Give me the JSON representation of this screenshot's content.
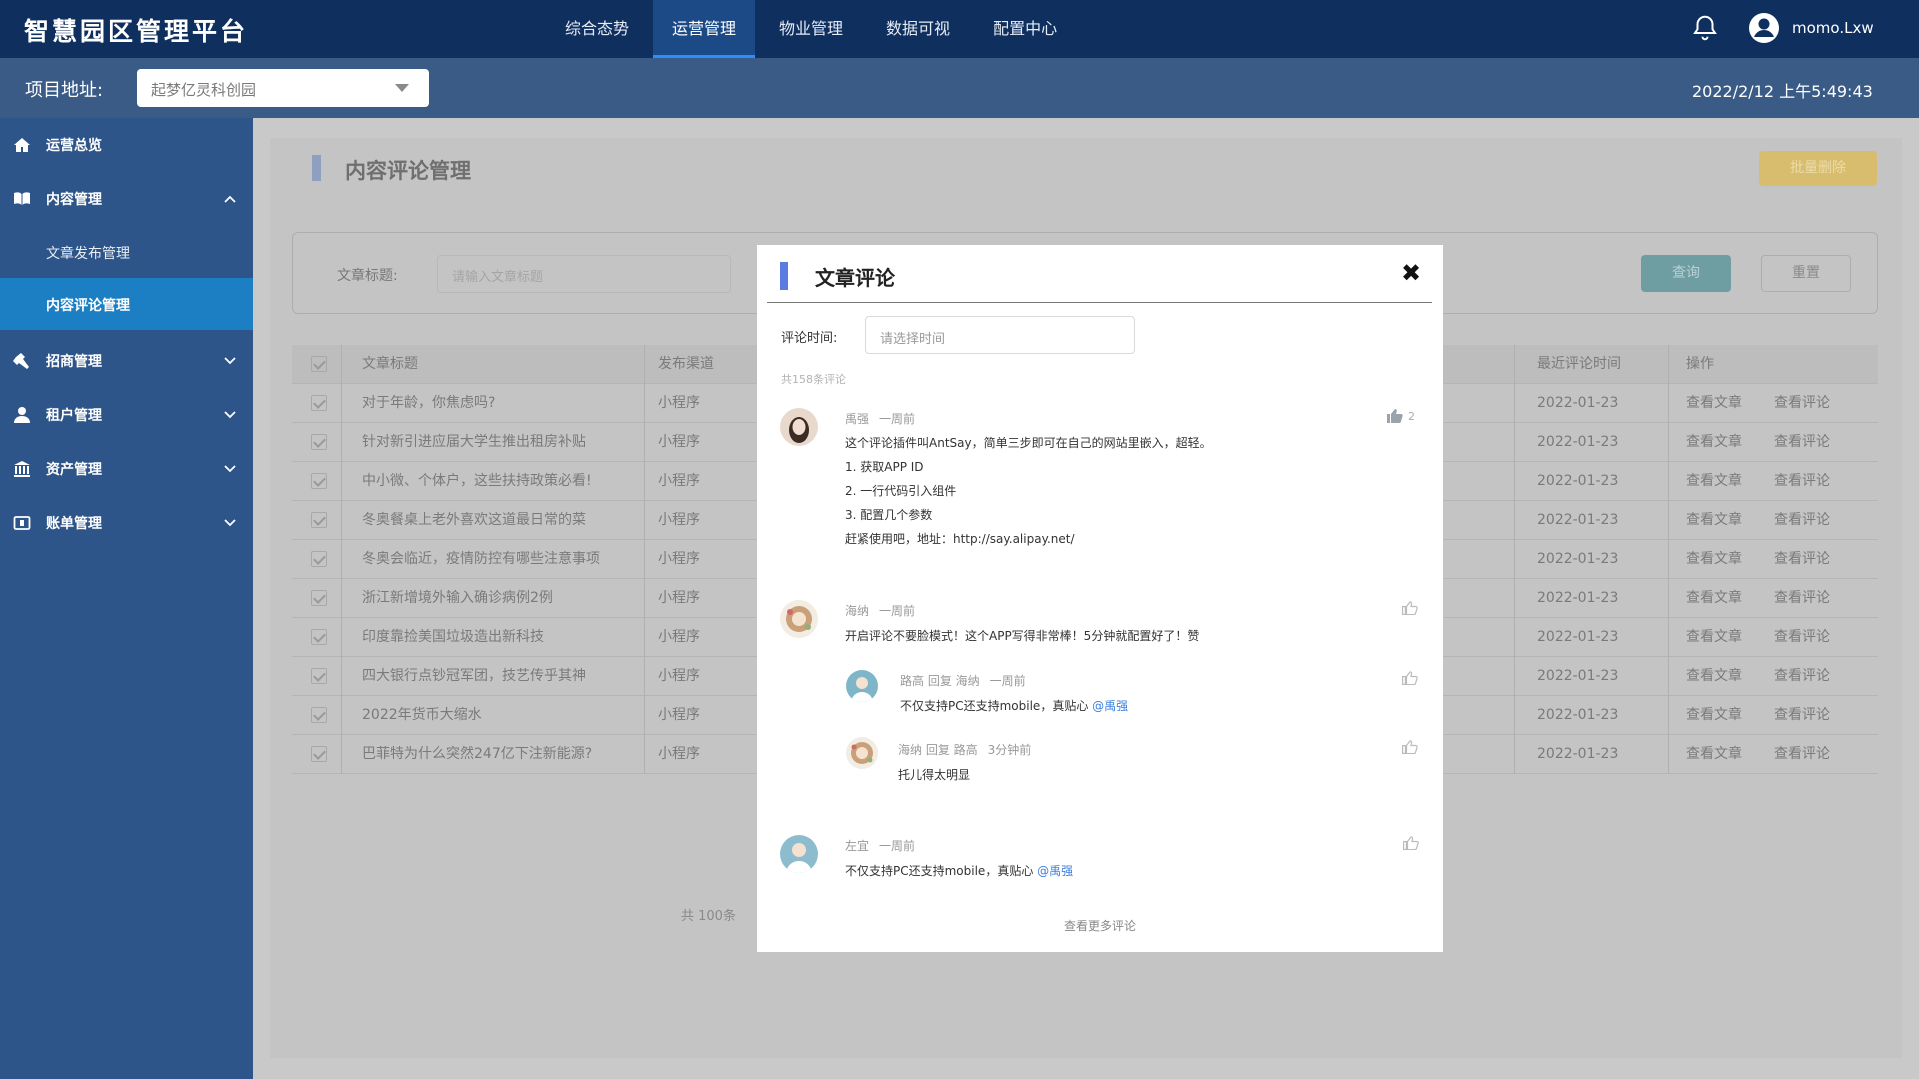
{
  "app": {
    "title": "智慧园区管理平台"
  },
  "topnav": [
    "综合态势",
    "运营管理",
    "物业管理",
    "数据可视",
    "配置中心"
  ],
  "user": {
    "name": "momo.Lxw"
  },
  "project": {
    "label": "项目地址:",
    "value": "起梦亿灵科创园"
  },
  "datetime": "2022/2/12 上午5:49:43",
  "sidebar": {
    "items": [
      {
        "label": "运营总览"
      },
      {
        "label": "内容管理"
      },
      {
        "label": "招商管理"
      },
      {
        "label": "租户管理"
      },
      {
        "label": "资产管理"
      },
      {
        "label": "账单管理"
      }
    ],
    "sub": [
      {
        "label": "文章发布管理"
      },
      {
        "label": "内容评论管理"
      }
    ]
  },
  "page": {
    "title": "内容评论管理",
    "batch_delete": "批量删除",
    "filter_label": "文章标题:",
    "filter_placeholder": "请输入文章标题",
    "query": "查询",
    "reset": "重置",
    "total": "共 100条"
  },
  "table": {
    "headers": [
      "文章标题",
      "发布渠道",
      "最近评论时间",
      "操作"
    ],
    "rows": [
      {
        "title": "对于年龄，你焦虑吗?",
        "channel": "小程序",
        "date": "2022-01-23"
      },
      {
        "title": "针对新引进应届大学生推出租房补贴",
        "channel": "小程序",
        "date": "2022-01-23"
      },
      {
        "title": "中小微、个体户，这些扶持政策必看!",
        "channel": "小程序",
        "date": "2022-01-23"
      },
      {
        "title": "冬奥餐桌上老外喜欢这道最日常的菜",
        "channel": "小程序",
        "date": "2022-01-23"
      },
      {
        "title": "冬奥会临近，疫情防控有哪些注意事项",
        "channel": "小程序",
        "date": "2022-01-23"
      },
      {
        "title": "浙江新增境外输入确诊病例2例",
        "channel": "小程序",
        "date": "2022-01-23"
      },
      {
        "title": "印度靠捡美国垃圾造出新科技",
        "channel": "小程序",
        "date": "2022-01-23"
      },
      {
        "title": "四大银行点钞冠军团，技艺传乎其神",
        "channel": "小程序",
        "date": "2022-01-23"
      },
      {
        "title": "2022年货币大缩水",
        "channel": "小程序",
        "date": "2022-01-23"
      },
      {
        "title": "巴菲特为什么突然247亿下注新能源?",
        "channel": "小程序",
        "date": "2022-01-23"
      }
    ],
    "op_view_article": "查看文章",
    "op_view_comment": "查看评论"
  },
  "modal": {
    "title": "文章评论",
    "close": "✖",
    "time_label": "评论时间:",
    "time_placeholder": "请选择时间",
    "count": "共158条评论",
    "more": "查看更多评论",
    "comments": [
      {
        "author": "禹强",
        "time": "一周前",
        "likes": "2",
        "lines": [
          "这个评论插件叫AntSay，简单三步即可在自己的网站里嵌入，超轻。",
          "1. 获取APP ID",
          "2. 一行代码引入组件",
          "3. 配置几个参数",
          "赶紧使用吧，地址：http://say.alipay.net/"
        ]
      },
      {
        "author": "海纳",
        "time": "一周前",
        "text": "开启评论不要脸模式！这个APP写得非常棒！5分钟就配置好了！赞",
        "replies": [
          {
            "author": "路高 回复 海纳",
            "time": "一周前",
            "text": "不仅支持PC还支持mobile，真贴心",
            "mention": "@禹强"
          },
          {
            "author": "海纳 回复 路高",
            "time": "3分钟前",
            "text": "托儿得太明显"
          }
        ]
      },
      {
        "author": "左宜",
        "time": "一周前",
        "text": "不仅支持PC还支持mobile，真贴心",
        "mention": "@禹强"
      }
    ]
  },
  "colors": {
    "topbar": "#0f2f5f",
    "sidebar": "#2e5589",
    "active": "#1c7fc4",
    "accent": "#5a7be0",
    "mention": "#3a7fe0"
  }
}
